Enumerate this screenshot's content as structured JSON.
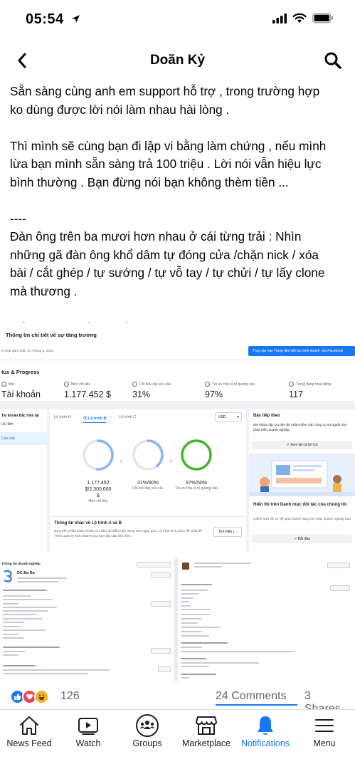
{
  "status_bar": {
    "time": "05:54"
  },
  "header": {
    "title": "Doãn Kỷ"
  },
  "post": {
    "lines": [
      "Sẵn sàng cùng anh em support hỗ trợ , trong trường hợp",
      "ko dùng được lời nói làm nhau hài lòng .",
      "",
      "Thì mình sẽ cùng bạn đi lập vi bằng làm chứng , nếu mình",
      "lừa bạn mình sẵn sàng trả 100 triệu . Lời nói vẫn hiệu lực",
      "bình thường . Bạn đừng nói bạn không thèm tiền ...",
      "",
      "----",
      "Đàn ông trên ba mươi hơn nhau ở cái từng trải : Nhìn",
      "những gã đàn ông khổ dâm tự đóng cửa /chặn nick / xóa",
      "bài / cắt ghép / tự sướng / tự vỗ tay / tự chửi / tự lấy clone",
      "mà thương .",
      "",
      "Sống trong thế giới của riêng mình mãi ko thoát ra được ."
    ]
  },
  "embedded_screenshot": {
    "title": "Thông tin chi tiết về sự tăng trưởng",
    "updated": "p nhật gần nhất: 14 Tháng 9, 2021",
    "top_button": "Truy cập vào Trung tâm đối tác kinh doanh của Facebook",
    "status_title": "tus & Progress",
    "metrics": [
      {
        "label": "Bậc",
        "value": "Tài khoản"
      },
      {
        "label": "Mức chi tiêu",
        "value": "1.177.452 $"
      },
      {
        "label": "Chỉ tiêu đạt yêu cầu",
        "value": "31%"
      },
      {
        "label": "Tối ưu hóa vị trí quảng cáo",
        "value": "97%"
      },
      {
        "label": "Trang đang hoạt động",
        "value": "117"
      }
    ],
    "left_nav": {
      "heading": "Tài khoản  Bắc hiện tại",
      "items": [
        "Ưu tiên",
        "Cao cấp"
      ]
    },
    "tabs": [
      "Lộ trình A",
      "Lộ trình B",
      "Lộ trình C"
    ],
    "currency": "USD",
    "rings": [
      {
        "line1": "1.177.452",
        "line2": "$/2.300.000",
        "line3": "$",
        "caption": "Mức chi tiêu",
        "progress": 0.51,
        "color": "#8ab4f8"
      },
      {
        "line1": "31%/80%",
        "line2": "",
        "line3": "",
        "caption": "Chỉ tiêu đạt yêu cầu",
        "progress": 0.39,
        "color": "#8ab4f8"
      },
      {
        "line1": "97%/50%",
        "line2": "",
        "line3": "",
        "caption": "Tối ưu hóa vị trí quảng cáo",
        "progress": 1.0,
        "color": "#42b72a"
      }
    ],
    "info_title": "Thông tin khác về Lộ trình A và B",
    "info_desc": "Dựa trên phần trăm khoản Chi tiêu đủ điều kiện trong 180 ngày qua, Lộ trình B là cách dễ nhất để Trình quản lý kinh doanh của bạn đạt cấp tiếp theo.",
    "info_button": "Tìm hiểu t...",
    "right": {
      "title": "Bậc tiếp theo",
      "desc": "Mở khóa cấp Ưu tiên để nhận thêm các công cụ và nguồn lực phát triển doanh nghiệp.",
      "button1": "Xem tất cả lợi ích",
      "title2": "Hiển thị trên Danh mục đối tác của chúng tôi",
      "desc2": "Chỉnh sửa hồ sơ để giúp khách hàng tìm thấy doanh nghiệp bạn.",
      "button2": "Bắt đầu"
    }
  },
  "embedded_screenshot2": {
    "left_title": "Thông tin doanh nghiệp",
    "company": "DC Ba Da"
  },
  "reactions": {
    "count": "126",
    "comments": "24 Comments",
    "shares": "3 Shares"
  },
  "tabbar": {
    "items": [
      {
        "label": "News Feed",
        "icon": "home-icon",
        "active": false
      },
      {
        "label": "Watch",
        "icon": "watch-icon",
        "active": false
      },
      {
        "label": "Groups",
        "icon": "groups-icon",
        "active": false
      },
      {
        "label": "Marketplace",
        "icon": "marketplace-icon",
        "active": false
      },
      {
        "label": "Notifications",
        "icon": "bell-icon",
        "active": true
      },
      {
        "label": "Menu",
        "icon": "menu-icon",
        "active": false
      }
    ],
    "active_color": "#1877f2"
  }
}
